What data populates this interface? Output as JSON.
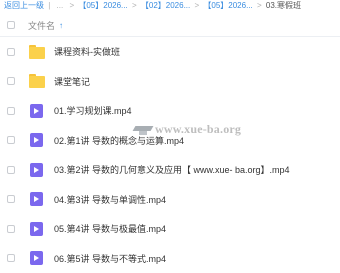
{
  "breadcrumb": {
    "back": "返回上一级",
    "sep1": "|",
    "ellipsis": "...",
    "items": [
      "【05】2026...",
      "【02】2026...",
      "【05】2026..."
    ],
    "current": "03.寒假班",
    "separator": ">"
  },
  "header": {
    "column_label": "文件名",
    "sort_indicator": "↑"
  },
  "files": [
    {
      "type": "folder",
      "name": "课程资料-实做班"
    },
    {
      "type": "folder",
      "name": "课堂笔记"
    },
    {
      "type": "video",
      "name": "01.学习规划课.mp4"
    },
    {
      "type": "video",
      "name": "02.第1讲 导数的概念与运算.mp4"
    },
    {
      "type": "video",
      "name": "03.第2讲 导数的几何意义及应用【 www.xue- ba.org】.mp4"
    },
    {
      "type": "video",
      "name": "04.第3讲 导数与单调性.mp4"
    },
    {
      "type": "video",
      "name": "05.第4讲 导数与极最值.mp4"
    },
    {
      "type": "video",
      "name": "06.第5讲 导数与不等式.mp4"
    }
  ],
  "watermark": {
    "text": "www.xue-ba.org"
  }
}
